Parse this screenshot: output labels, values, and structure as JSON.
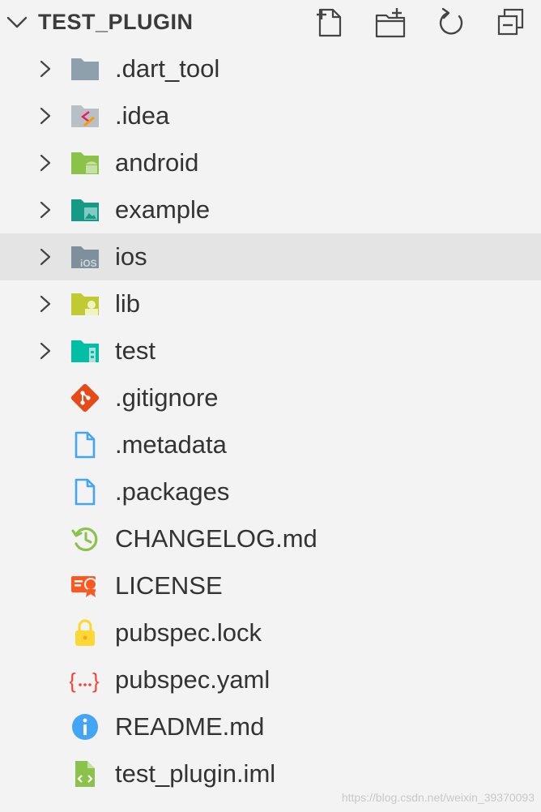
{
  "explorer": {
    "title": "TEST_PLUGIN",
    "actions": [
      {
        "name": "new-file-icon"
      },
      {
        "name": "new-folder-icon"
      },
      {
        "name": "refresh-icon"
      },
      {
        "name": "collapse-all-icon"
      }
    ]
  },
  "items": [
    {
      "label": ".dart_tool",
      "type": "folder",
      "icon": "folder-icon",
      "color": "#8fa0ad"
    },
    {
      "label": ".idea",
      "type": "folder",
      "icon": "folder-idea-icon",
      "color": "#b8c0c6"
    },
    {
      "label": "android",
      "type": "folder",
      "icon": "folder-android-icon",
      "color": "#8bc34a"
    },
    {
      "label": "example",
      "type": "folder",
      "icon": "folder-images-icon",
      "color": "#159a86"
    },
    {
      "label": "ios",
      "type": "folder",
      "icon": "folder-ios-icon",
      "color": "#7f8f9b"
    },
    {
      "label": "lib",
      "type": "folder",
      "icon": "folder-lib-icon",
      "color": "#c0ca33"
    },
    {
      "label": "test",
      "type": "folder",
      "icon": "folder-test-icon",
      "color": "#00bfa5"
    },
    {
      "label": ".gitignore",
      "type": "file",
      "icon": "git-icon",
      "color": "#e64a19"
    },
    {
      "label": ".metadata",
      "type": "file",
      "icon": "document-icon",
      "color": "#42a5f5"
    },
    {
      "label": ".packages",
      "type": "file",
      "icon": "document-icon",
      "color": "#42a5f5"
    },
    {
      "label": "CHANGELOG.md",
      "type": "file",
      "icon": "changelog-icon",
      "color": "#8bc34a"
    },
    {
      "label": "LICENSE",
      "type": "file",
      "icon": "license-icon",
      "color": "#ff5722"
    },
    {
      "label": "pubspec.lock",
      "type": "file",
      "icon": "lock-icon",
      "color": "#fdd835"
    },
    {
      "label": "pubspec.yaml",
      "type": "file",
      "icon": "yaml-icon",
      "color": "#f44336"
    },
    {
      "label": "README.md",
      "type": "file",
      "icon": "info-icon",
      "color": "#42a5f5"
    },
    {
      "label": "test_plugin.iml",
      "type": "file",
      "icon": "xml-file-icon",
      "color": "#8bc34a"
    }
  ],
  "selected_label": "ios",
  "watermark": "https://blog.csdn.net/weixin_39370093"
}
